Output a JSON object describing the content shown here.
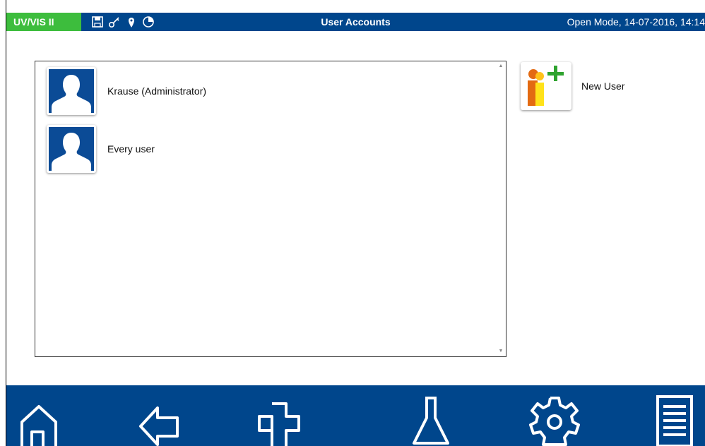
{
  "header": {
    "device_badge": "UV/VIS II",
    "title": "User Accounts",
    "mode_text": "Open Mode, 14-07-2016, 14:14",
    "status_icons": [
      "save-icon",
      "key-icon",
      "location-pin-icon",
      "pie-chart-icon"
    ]
  },
  "user_list": {
    "users": [
      {
        "label": "Krause (Administrator)"
      },
      {
        "label": "Every user"
      }
    ]
  },
  "actions": {
    "new_user_label": "New User"
  },
  "nav": {
    "icons": [
      "home-icon",
      "back-arrow-icon",
      "plus-icon",
      "flask-icon",
      "gear-icon",
      "menu-icon"
    ]
  },
  "colors": {
    "bar_blue": "#00468c",
    "badge_green": "#3dbd3d"
  }
}
